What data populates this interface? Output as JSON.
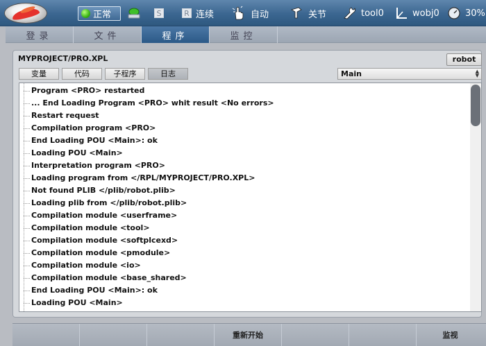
{
  "topbar": {
    "status": "正常",
    "s_label": "S",
    "r_label": "R",
    "mode": "连续",
    "run_mode": "自动",
    "joint": "关节",
    "tool": "tool0",
    "wobj": "wobj0",
    "speed": "30%"
  },
  "tabs": [
    "登录",
    "文件",
    "程序",
    "监控"
  ],
  "panel": {
    "path": "MYPROJECT/PRO.XPL",
    "robot_button": "robot",
    "subtabs": [
      "变量",
      "代码",
      "子程序",
      "日志"
    ],
    "selector_value": "Main"
  },
  "log": [
    "Program <PRO> restarted",
    "... End Loading Program <PRO> whit result <No errors>",
    "Restart request",
    "Compilation program <PRO>",
    "End Loading POU <Main>: ok",
    "Loading POU <Main>",
    "Interpretation program <PRO>",
    "Loading program from </RPL/MYPROJECT/PRO.XPL>",
    "Not found PLIB </plib/robot.plib>",
    "Loading plib from </plib/robot.plib>",
    "Compilation module <userframe>",
    "Compilation module <tool>",
    "Compilation module <softplcexd>",
    "Compilation module <pmodule>",
    "Compilation module <io>",
    "Compilation module <base_shared>",
    "End Loading POU <Main>: ok",
    "Loading POU <Main>"
  ],
  "bottombar": {
    "restart": "重新开始",
    "monitor": "监视"
  }
}
